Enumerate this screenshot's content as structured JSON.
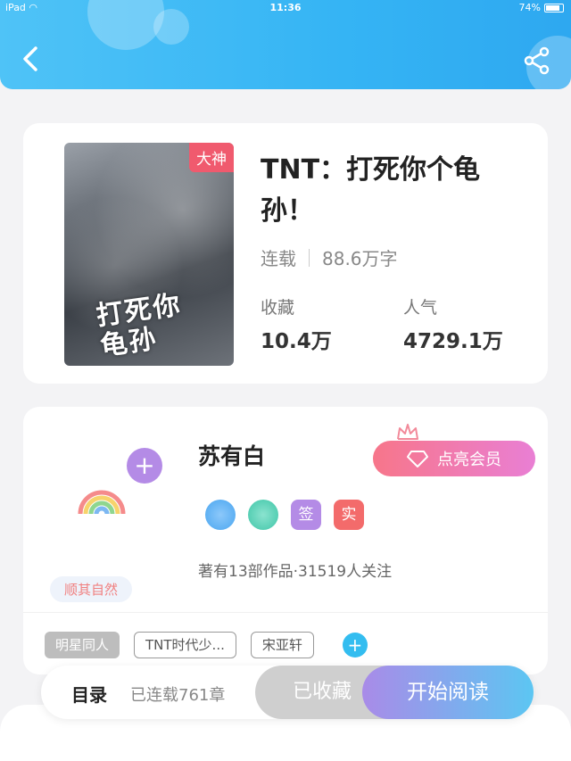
{
  "status_bar": {
    "device": "iPad",
    "time": "11:36",
    "battery": "74%"
  },
  "header": {
    "back_icon": "back-chevron-icon",
    "share_icon": "share-icon"
  },
  "book": {
    "cover_tag": "大神",
    "cover_title": "打死你龟孙",
    "title": "TNT：打死你个龟孙！",
    "status": "连载",
    "word_count": "88.6万字",
    "stats": [
      {
        "label": "收藏",
        "value": "10.4万"
      },
      {
        "label": "人气",
        "value": "4729.1万"
      }
    ]
  },
  "author": {
    "name": "苏有白",
    "follow_plus": "+",
    "vip_label": "点亮会员",
    "mood": "顺其自然",
    "badges": [
      {
        "icon": "phone-medal-icon",
        "color": "#4aa6f0"
      },
      {
        "icon": "handshake-medal-icon",
        "color": "#3fc6a8"
      },
      {
        "label": "签",
        "color": "#b48be6"
      },
      {
        "label": "实",
        "color": "#f36b6b"
      }
    ],
    "info": "著有13部作品·31519人关注"
  },
  "tags": {
    "items": [
      "明星同人",
      "TNT时代少...",
      "宋亚轩"
    ],
    "add": "+"
  },
  "bottom_bar": {
    "toc_label": "目录",
    "chapter_status": "已连载761章",
    "saved_label": "已收藏",
    "read_label": "开始阅读"
  }
}
